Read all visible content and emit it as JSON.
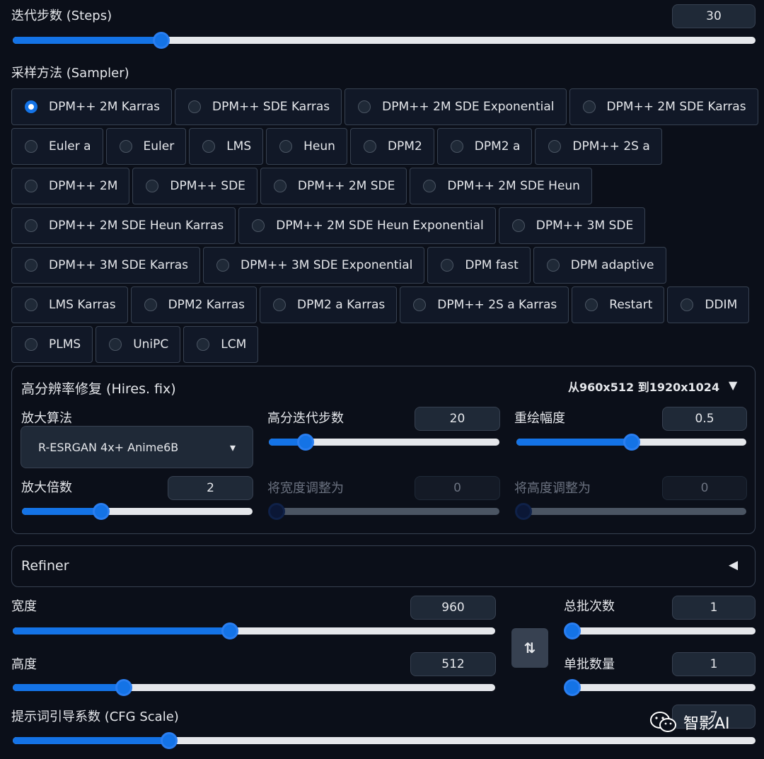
{
  "steps": {
    "label": "迭代步数 (Steps)",
    "value": "30",
    "fraction": 0.2
  },
  "sampler": {
    "label": "采样方法 (Sampler)",
    "selected": "DPM++ 2M Karras",
    "rows": [
      [
        "DPM++ 2M Karras",
        "DPM++ SDE Karras",
        "DPM++ 2M SDE Exponential",
        "DPM++ 2M SDE Karras"
      ],
      [
        "Euler a",
        "Euler",
        "LMS",
        "Heun",
        "DPM2",
        "DPM2 a",
        "DPM++ 2S a"
      ],
      [
        "DPM++ 2M",
        "DPM++ SDE",
        "DPM++ 2M SDE",
        "DPM++ 2M SDE Heun"
      ],
      [
        "DPM++ 2M SDE Heun Karras",
        "DPM++ 2M SDE Heun Exponential",
        "DPM++ 3M SDE"
      ],
      [
        "DPM++ 3M SDE Karras",
        "DPM++ 3M SDE Exponential",
        "DPM fast",
        "DPM adaptive"
      ],
      [
        "LMS Karras",
        "DPM2 Karras",
        "DPM2 a Karras",
        "DPM++ 2S a Karras",
        "Restart",
        "DDIM"
      ],
      [
        "PLMS",
        "UniPC",
        "LCM"
      ]
    ]
  },
  "hires": {
    "title": "高分辨率修复 (Hires. fix)",
    "summary": "从960x512 到1920x1024",
    "toggle_icon": "▼",
    "upscaler": {
      "label": "放大算法",
      "value": "R-ESRGAN 4x+ Anime6B",
      "dropdown_icon": "▾"
    },
    "hires_steps": {
      "label": "高分迭代步数",
      "value": "20",
      "fraction": 0.16
    },
    "denoise": {
      "label": "重绘幅度",
      "value": "0.5",
      "fraction": 0.5
    },
    "scale": {
      "label": "放大倍数",
      "value": "2",
      "fraction": 0.345
    },
    "resize_w": {
      "label": "将宽度调整为",
      "value": "0",
      "fraction": 0
    },
    "resize_h": {
      "label": "将高度调整为",
      "value": "0",
      "fraction": 0
    }
  },
  "refiner": {
    "label": "Refiner",
    "toggle_icon": "◀"
  },
  "width": {
    "label": "宽度",
    "value": "960",
    "fraction": 0.45
  },
  "height": {
    "label": "高度",
    "value": "512",
    "fraction": 0.23
  },
  "swap_icon": "⇅",
  "batch_count": {
    "label": "总批次数",
    "value": "1",
    "fraction": 0
  },
  "batch_size": {
    "label": "单批数量",
    "value": "1",
    "fraction": 0
  },
  "cfg": {
    "label": "提示词引导系数 (CFG Scale)",
    "value": "7",
    "fraction": 0.21
  },
  "watermark": {
    "icon": "wechat-icon",
    "text": "智影AI"
  },
  "colors": {
    "accent": "#1473e6",
    "background": "#0b0f19",
    "input_bg": "#1f2937",
    "border": "#374151"
  }
}
